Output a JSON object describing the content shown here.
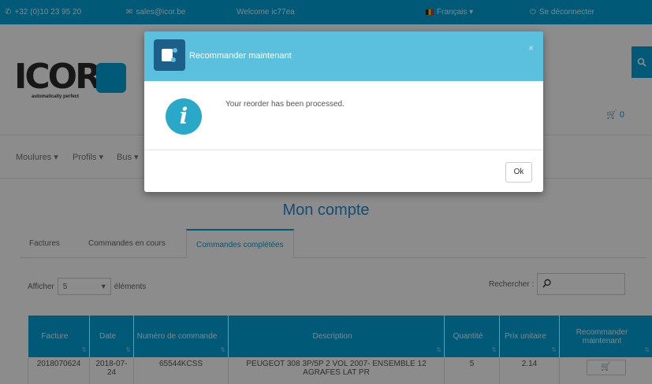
{
  "topbar": {
    "phone": "+32 (0)10 23 95 20",
    "email": "sales@icor.be",
    "welcome": "Welcome ic77ea",
    "language": "Français ▾",
    "logout": "Se déconnecter"
  },
  "header": {
    "logo_text": "ICOR",
    "logo_tagline": "automatically perfect",
    "cart_count": "0"
  },
  "nav": [
    "Moulures ▾",
    "Profils ▾",
    "Bus ▾"
  ],
  "account": {
    "title": "Mon compte",
    "tabs": [
      "Factures",
      "Commandes en cours",
      "Commandes complétées"
    ],
    "show_label": "Afficher",
    "show_value": "5",
    "show_suffix": "éléments",
    "search_label": "Rechercher :"
  },
  "table": {
    "headers": [
      "Facture",
      "Date",
      "Numéro de commande",
      "Description",
      "Quantité",
      "Prix unitaire",
      "Recommander maintenant"
    ],
    "rows": [
      {
        "facture": "2018070624",
        "date": "2018-07-24",
        "numero": "65544KCSS",
        "description": "PEUGEOT 308 3P/5P 2 VOL 2007- ENSEMBLE 12 AGRAFES LAT PR",
        "quantite": "5",
        "prix": "2.14"
      }
    ]
  },
  "modal": {
    "title": "Recommander maintenant",
    "close": "×",
    "message": "Your reorder has been processed.",
    "info_glyph": "i",
    "ok_label": "Ok"
  },
  "colors": {
    "accent": "#00a3d8",
    "modal_header": "#5bc0de",
    "info": "#2aa8c8",
    "title_blue": "#2a8ad0"
  }
}
